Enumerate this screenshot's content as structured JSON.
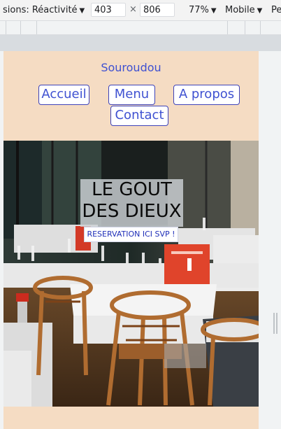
{
  "devtools": {
    "dimensions_label": "sions: Réactivité",
    "width_value": "403",
    "times_symbol": "×",
    "height_value": "806",
    "zoom_label": "77%",
    "device_label": "Mobile",
    "throttle_label": "Pe"
  },
  "site": {
    "brand": "Souroudou",
    "nav": [
      {
        "label": "Accueil"
      },
      {
        "label": "Menu"
      },
      {
        "label": "A propos"
      },
      {
        "label": "Contact"
      }
    ],
    "hero": {
      "title": "LE GOUT\nDES DIEUX",
      "cta": "RESERVATION ICI SVP !",
      "image": "restaurant-terrace-photo"
    }
  },
  "colors": {
    "page_background": "#f5dcc3",
    "link_blue": "#3f51d1",
    "nav_border": "#3e43b8"
  }
}
